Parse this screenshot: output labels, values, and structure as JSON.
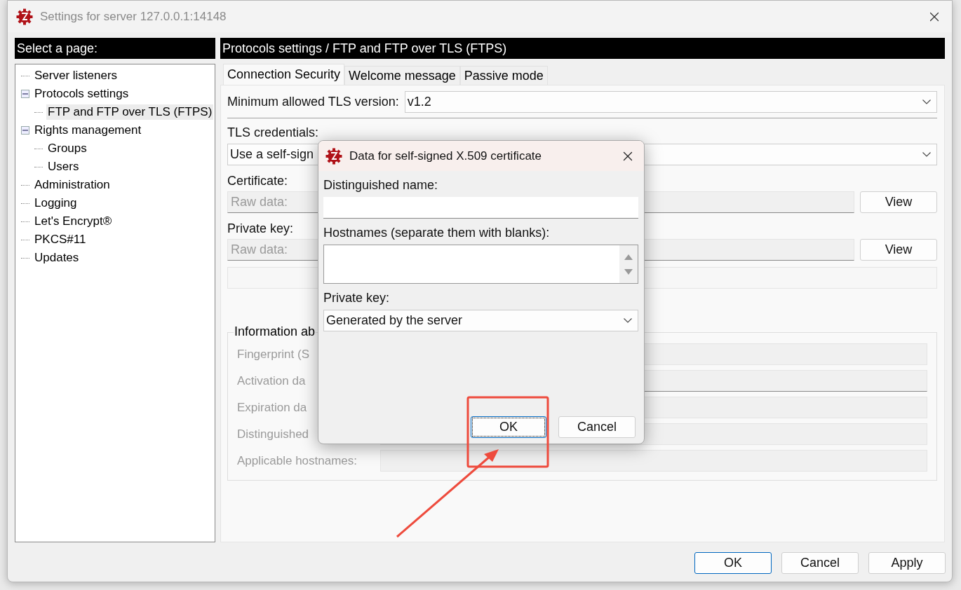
{
  "window": {
    "title": "Settings for server 127.0.0.1:14148"
  },
  "sidebar": {
    "header": "Select a page:",
    "tree": [
      {
        "label": "Server listeners",
        "selected": false
      },
      {
        "label": "Protocols settings",
        "selected": false,
        "expanded": true,
        "children": [
          {
            "label": "FTP and FTP over TLS (FTPS)",
            "selected": true
          }
        ]
      },
      {
        "label": "Rights management",
        "selected": false,
        "expanded": true,
        "children": [
          {
            "label": "Groups",
            "selected": false
          },
          {
            "label": "Users",
            "selected": false
          }
        ]
      },
      {
        "label": "Administration",
        "selected": false
      },
      {
        "label": "Logging",
        "selected": false
      },
      {
        "label": "Let's Encrypt®",
        "selected": false
      },
      {
        "label": "PKCS#11",
        "selected": false
      },
      {
        "label": "Updates",
        "selected": false
      }
    ]
  },
  "page": {
    "header": "Protocols settings / FTP and FTP over TLS (FTPS)",
    "tabs": [
      {
        "label": "Connection Security",
        "selected": true
      },
      {
        "label": "Welcome message",
        "selected": false
      },
      {
        "label": "Passive mode",
        "selected": false
      }
    ],
    "min_tls": {
      "label": "Minimum allowed TLS version:",
      "value": "v1.2"
    },
    "credentials": {
      "label": "TLS credentials:",
      "value": "Use a self-sign"
    },
    "certificate": {
      "label": "Certificate:",
      "placeholder": "Raw data:",
      "button": "View"
    },
    "private_key": {
      "label": "Private key:",
      "placeholder": "Raw data:",
      "button": "View"
    },
    "info": {
      "title": "Information ab",
      "rows": [
        {
          "label": "Fingerprint (S"
        },
        {
          "label": "Activation da"
        },
        {
          "label": "Expiration da"
        },
        {
          "label": "Distinguished"
        },
        {
          "label": "Applicable hostnames:"
        }
      ]
    }
  },
  "buttons": [
    {
      "label": "OK",
      "default": true
    },
    {
      "label": "Cancel",
      "default": false
    },
    {
      "label": "Apply",
      "default": false
    }
  ],
  "dialog": {
    "title": "Data for self-signed X.509 certificate",
    "dn_label": "Distinguished name:",
    "hosts_label": "Hostnames (separate them with blanks):",
    "key_label": "Private key:",
    "key_value": "Generated by the server",
    "buttons": [
      {
        "label": "OK",
        "focused": true
      },
      {
        "label": "Cancel",
        "focused": false
      }
    ]
  }
}
